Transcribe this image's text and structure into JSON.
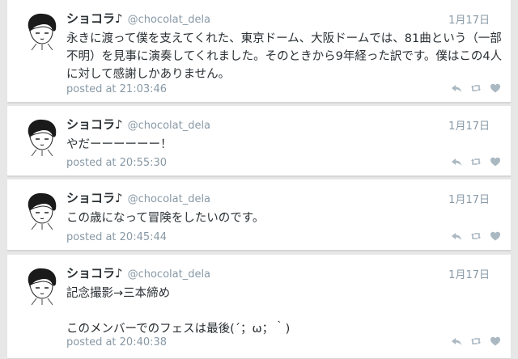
{
  "timeline": {
    "tweets": [
      {
        "display_name": "ショコラ♪",
        "screen_name": "@chocolat_dela",
        "date": "1月17日",
        "text": "永きに渡って僕を支えてくれた、東京ドーム、大阪ドームでは、81曲という（一部\n不明）を見事に演奏してくれました。そのときから9年経った訳です。僕はこの4人\nに対して感謝しかありません。",
        "posted_at": "posted at 21:03:46"
      },
      {
        "display_name": "ショコラ♪",
        "screen_name": "@chocolat_dela",
        "date": "1月17日",
        "text": "やだーーーーーー！",
        "posted_at": "posted at 20:55:30"
      },
      {
        "display_name": "ショコラ♪",
        "screen_name": "@chocolat_dela",
        "date": "1月17日",
        "text": "この歳になって冒険をしたいのです。",
        "posted_at": "posted at 20:45:44"
      },
      {
        "display_name": "ショコラ♪",
        "screen_name": "@chocolat_dela",
        "date": "1月17日",
        "text": "記念撮影→三本締め\n\nこのメンバーでのフェスは最後(´；ω；｀)",
        "posted_at": "posted at 20:40:38"
      }
    ]
  },
  "icons": {
    "reply": "reply-icon",
    "retweet": "retweet-icon",
    "favorite": "heart-icon"
  },
  "colors": {
    "background": "#e7e7e7",
    "card": "#ffffff",
    "muted_text": "#8899a6",
    "icon": "#aab8c2"
  }
}
